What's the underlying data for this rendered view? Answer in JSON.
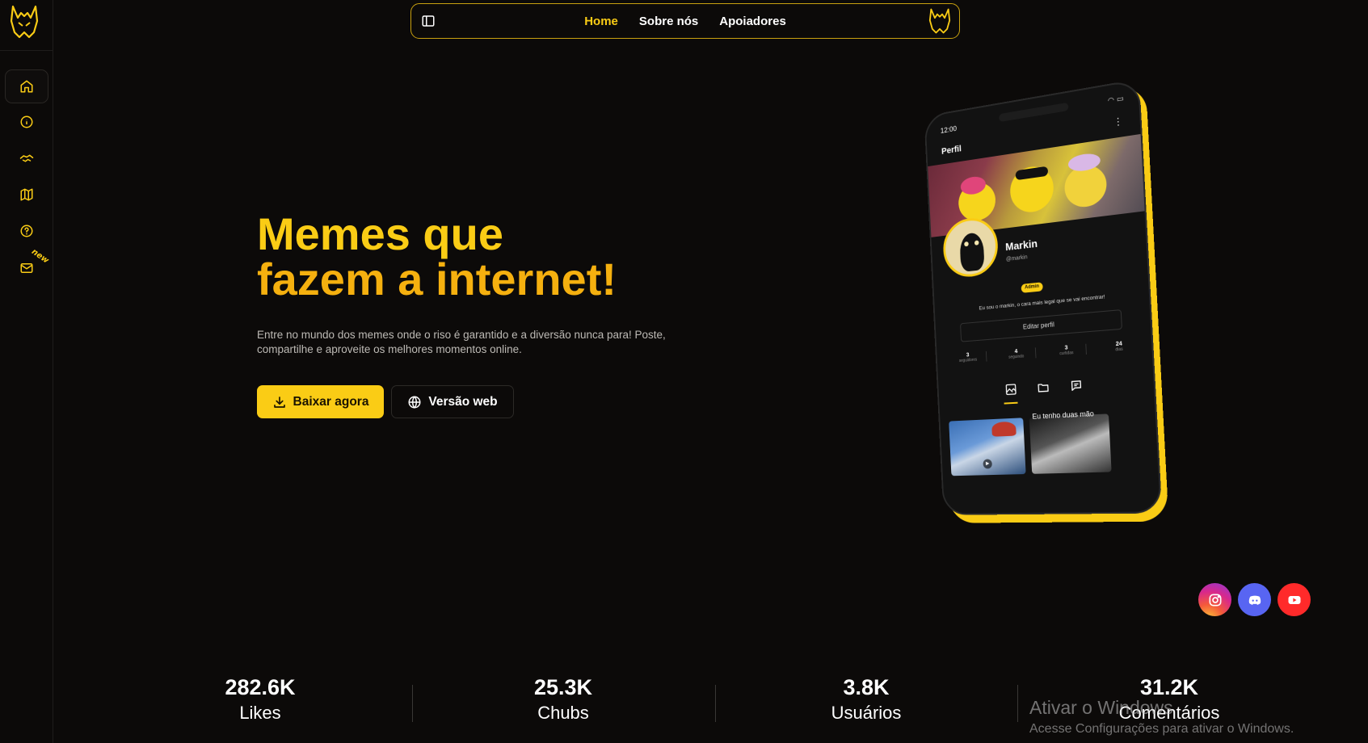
{
  "nav": {
    "links": [
      "Home",
      "Sobre nós",
      "Apoiadores"
    ],
    "active": "Home"
  },
  "sidebar": {
    "items": [
      {
        "icon": "home-icon"
      },
      {
        "icon": "info-icon"
      },
      {
        "icon": "handshake-icon"
      },
      {
        "icon": "map-icon"
      },
      {
        "icon": "help-circle-icon"
      },
      {
        "icon": "mail-icon",
        "badge": "new"
      }
    ]
  },
  "hero": {
    "title_line1": "Memes que",
    "title_line2": "fazem a internet!",
    "description": "Entre no mundo dos memes onde o riso é garantido e a diversão nunca para! Poste, compartilhe e aproveite os melhores momentos online.",
    "download_label": "Baixar agora",
    "web_label": "Versão web"
  },
  "phone": {
    "time": "12:00",
    "screen_title": "Perfil",
    "name": "Markin",
    "handle": "@markin",
    "role_badge": "Admin",
    "bio": "Eu sou o markin, o cara mais legal que se vai encontrar!",
    "edit_label": "Editar perfil",
    "stats": [
      {
        "value": "3",
        "label": "seguidores"
      },
      {
        "value": "4",
        "label": "seguindo"
      },
      {
        "value": "3",
        "label": "curtidas"
      },
      {
        "value": "24",
        "label": "dias"
      }
    ],
    "post_caption": "Eu tenho duas mão"
  },
  "social": [
    {
      "name": "instagram",
      "color": "#e1306c"
    },
    {
      "name": "discord",
      "color": "#5865f2"
    },
    {
      "name": "youtube",
      "color": "#ff2a2a"
    }
  ],
  "stats": [
    {
      "value": "282.6K",
      "label": "Likes"
    },
    {
      "value": "25.3K",
      "label": "Chubs"
    },
    {
      "value": "3.8K",
      "label": "Usuários"
    },
    {
      "value": "31.2K",
      "label": "Comentários"
    }
  ],
  "watermark": {
    "line1": "Ativar o Windows",
    "line2": "Acesse Configurações para ativar o Windows."
  },
  "colors": {
    "accent": "#facc15",
    "background": "#0c0a09"
  }
}
